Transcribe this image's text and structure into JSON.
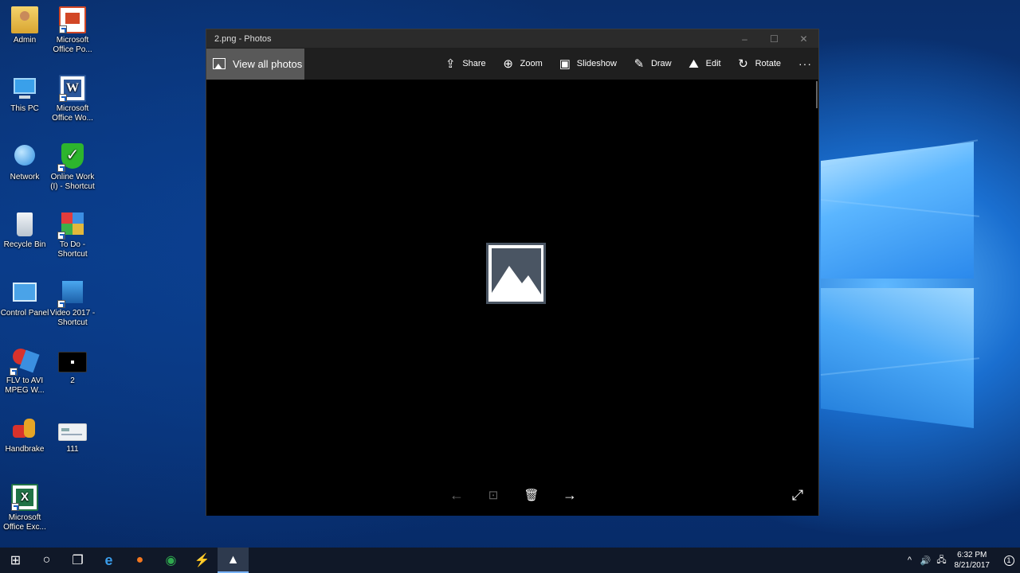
{
  "desktop": {
    "icons": [
      {
        "label": "Admin",
        "icon": "user-folder-icon"
      },
      {
        "label": "Microsoft Office Po...",
        "icon": "powerpoint-icon"
      },
      {
        "label": "This PC",
        "icon": "computer-icon"
      },
      {
        "label": "Microsoft Office Wo...",
        "icon": "word-icon"
      },
      {
        "label": "Network",
        "icon": "network-icon"
      },
      {
        "label": "Online Work (I) - Shortcut",
        "icon": "shield-check-icon"
      },
      {
        "label": "Recycle Bin",
        "icon": "recycle-bin-icon"
      },
      {
        "label": "To Do - Shortcut",
        "icon": "todo-app-icon"
      },
      {
        "label": "Control Panel",
        "icon": "control-panel-icon"
      },
      {
        "label": "Video 2017 - Shortcut",
        "icon": "video-app-icon"
      },
      {
        "label": "FLV to AVI MPEG W...",
        "icon": "converter-icon"
      },
      {
        "label": "2",
        "icon": "image-thumbnail-icon"
      },
      {
        "label": "Handbrake",
        "icon": "handbrake-icon"
      },
      {
        "label": "111",
        "icon": "image-thumbnail-icon"
      },
      {
        "label": "Microsoft Office Exc...",
        "icon": "excel-icon"
      }
    ]
  },
  "window": {
    "title": "2.png - Photos",
    "controls": {
      "minimize": "–",
      "maximize": "☐",
      "close": "✕"
    },
    "view_all": "View all photos",
    "tools": [
      {
        "label": "Share",
        "icon": "share-icon",
        "glyph": "⇪"
      },
      {
        "label": "Zoom",
        "icon": "zoom-icon",
        "glyph": "⊕"
      },
      {
        "label": "Slideshow",
        "icon": "slideshow-icon",
        "glyph": "▣"
      },
      {
        "label": "Draw",
        "icon": "draw-icon",
        "glyph": "✎"
      },
      {
        "label": "Edit",
        "icon": "edit-icon",
        "glyph": "⛰"
      },
      {
        "label": "Rotate",
        "icon": "rotate-icon",
        "glyph": "↻"
      }
    ],
    "more": "···",
    "bottom": {
      "prev": "←",
      "present": "⊡",
      "delete": "🗑",
      "next": "→",
      "fullscreen": "⤢"
    }
  },
  "taskbar": {
    "items": [
      {
        "name": "start-button",
        "glyph": "⊞"
      },
      {
        "name": "cortana-button",
        "glyph": "○"
      },
      {
        "name": "task-view-button",
        "glyph": "❐"
      },
      {
        "name": "edge-taskbar-icon",
        "glyph": "e"
      },
      {
        "name": "firefox-taskbar-icon",
        "glyph": "●"
      },
      {
        "name": "chrome-taskbar-icon",
        "glyph": "◉"
      },
      {
        "name": "app-taskbar-icon",
        "glyph": "⚡"
      },
      {
        "name": "photos-taskbar-icon",
        "glyph": "▲"
      }
    ],
    "tray": {
      "chevron": "^",
      "volume": "🔊",
      "network": "🖧"
    },
    "time": "6:32 PM",
    "date": "8/21/2017",
    "notification_count": "1"
  }
}
